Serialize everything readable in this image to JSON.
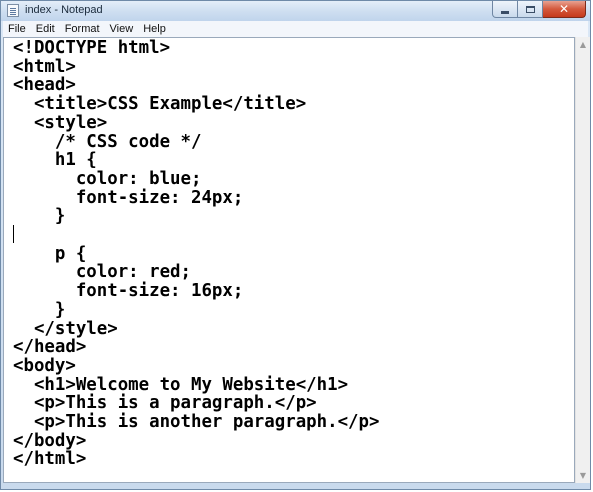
{
  "window": {
    "title": "index - Notepad"
  },
  "menu": [
    "File",
    "Edit",
    "Format",
    "View",
    "Help"
  ],
  "editor": {
    "text": "<!DOCTYPE html>\n<html>\n<head>\n  <title>CSS Example</title>\n  <style>\n    /* CSS code */\n    h1 {\n      color: blue;\n      font-size: 24px;\n    }\n\n    p {\n      color: red;\n      font-size: 16px;\n    }\n  </style>\n</head>\n<body>\n  <h1>Welcome to My Website</h1>\n  <p>This is a paragraph.</p>\n  <p>This is another paragraph.</p>\n</body>\n</html>"
  },
  "icons": {
    "app": "notepad-icon",
    "minimize": "minimize-icon",
    "maximize": "maximize-icon",
    "close": "close-icon",
    "scroll_up": "scroll-up-arrow-icon",
    "scroll_down": "scroll-down-arrow-icon"
  },
  "colors": {
    "close_button": "#c5391c",
    "titlebar": "#cfdff1",
    "text": "#000000"
  }
}
